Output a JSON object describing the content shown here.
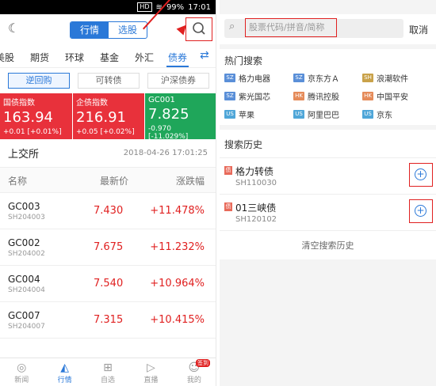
{
  "status": {
    "hd": "HD",
    "battery": "99%",
    "time": "17:01"
  },
  "left": {
    "tabs": {
      "market": "行情",
      "watch": "选股"
    },
    "categories": [
      "美股",
      "期货",
      "环球",
      "基金",
      "外汇",
      "债券"
    ],
    "subtabs": [
      "逆回购",
      "可转债",
      "沪深债券"
    ],
    "cards": [
      {
        "name": "国债指数",
        "value": "163.94",
        "change": "+0.01 [+0.01%]",
        "color": "#e8313b"
      },
      {
        "name": "企债指数",
        "value": "216.91",
        "change": "+0.05 [+0.02%]",
        "color": "#e8313b"
      },
      {
        "name": "GC001",
        "value": "7.825",
        "change": "-0.970 [-11.029%]",
        "color": "#1fa65a"
      }
    ],
    "section": {
      "name": "上交所",
      "time": "2018-04-26 17:01:25"
    },
    "headers": {
      "name": "名称",
      "price": "最新价",
      "change": "涨跌幅"
    },
    "rows": [
      {
        "name": "GC003",
        "code": "SH204003",
        "price": "7.430",
        "pct": "+11.478%"
      },
      {
        "name": "GC002",
        "code": "SH204002",
        "price": "7.675",
        "pct": "+11.232%"
      },
      {
        "name": "GC004",
        "code": "SH204004",
        "price": "7.540",
        "pct": "+10.964%"
      },
      {
        "name": "GC007",
        "code": "SH204007",
        "price": "7.315",
        "pct": "+10.415%"
      }
    ],
    "nav": [
      "新闻",
      "行情",
      "自选",
      "直播",
      "我的"
    ],
    "nav_badge": "签到"
  },
  "right": {
    "placeholder": "股票代码/拼音/简称",
    "cancel": "取消",
    "hot_title": "热门搜索",
    "hot": [
      {
        "tag": "SZ",
        "name": "格力电器",
        "color": "#5a8fd8"
      },
      {
        "tag": "SZ",
        "name": "京东方Ａ",
        "color": "#5a8fd8"
      },
      {
        "tag": "SH",
        "name": "浪潮软件",
        "color": "#c9a24a"
      },
      {
        "tag": "SZ",
        "name": "紫光国芯",
        "color": "#5a8fd8"
      },
      {
        "tag": "HK",
        "name": "腾讯控股",
        "color": "#e58b5a"
      },
      {
        "tag": "HK",
        "name": "中国平安",
        "color": "#e58b5a"
      },
      {
        "tag": "US",
        "name": "苹果",
        "color": "#4fa6d8"
      },
      {
        "tag": "US",
        "name": "阿里巴巴",
        "color": "#4fa6d8"
      },
      {
        "tag": "US",
        "name": "京东",
        "color": "#4fa6d8"
      }
    ],
    "history_title": "搜索历史",
    "history": [
      {
        "badge": "债",
        "name": "格力转债",
        "code": "SH110030"
      },
      {
        "badge": "债",
        "name": "01三峡债",
        "code": "SH120102"
      }
    ],
    "clear": "清空搜索历史"
  }
}
